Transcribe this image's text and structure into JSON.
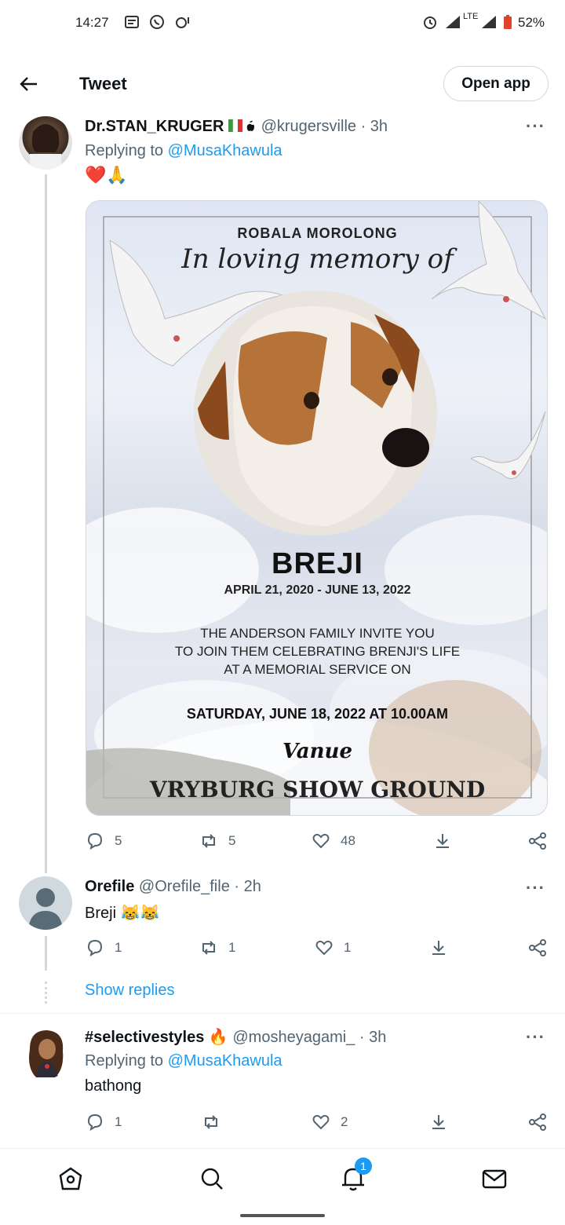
{
  "status_bar": {
    "time": "14:27",
    "battery": "52%",
    "network": "LTE"
  },
  "header": {
    "title": "Tweet",
    "open_app": "Open app"
  },
  "main_tweet": {
    "name": "Dr.STAN_KRUGER",
    "handle": "@krugersville",
    "time": "· 3h",
    "replying_prefix": "Replying to",
    "replying_to": "@MusaKhawula",
    "text": "❤️🙏",
    "image": {
      "top_line": "ROBALA MOROLONG",
      "script_line": "In loving memory of",
      "pet_name": "BREJI",
      "dates": "APRIL 21, 2020 - JUNE 13, 2022",
      "invite_1": "THE ANDERSON FAMILY INVITE YOU",
      "invite_2": "TO JOIN THEM CELEBRATING BRENJI'S LIFE",
      "invite_3": "AT A MEMORIAL SERVICE ON",
      "date_time": "SATURDAY, JUNE 18, 2022 AT 10.00AM",
      "venue_label": "Vanue",
      "venue": "VRYBURG SHOW GROUND"
    },
    "replies": "5",
    "retweets": "5",
    "likes": "48"
  },
  "reply1": {
    "name": "Orefile",
    "handle": "@Orefile_file",
    "time": "· 2h",
    "text": "Breji 😹😹",
    "replies": "1",
    "retweets": "1",
    "likes": "1",
    "show_replies": "Show replies"
  },
  "reply2": {
    "name": "#selectivestyles 🔥",
    "handle": "@mosheyagami_",
    "time": "· 3h",
    "replying_prefix": "Replying to",
    "replying_to": "@MusaKhawula",
    "text": "bathong",
    "replies": "1",
    "likes": "2"
  },
  "bottom_nav": {
    "notification_count": "1"
  },
  "colors": {
    "accent": "#1d9bf0",
    "text": "#0f1419",
    "secondary": "#536471"
  }
}
